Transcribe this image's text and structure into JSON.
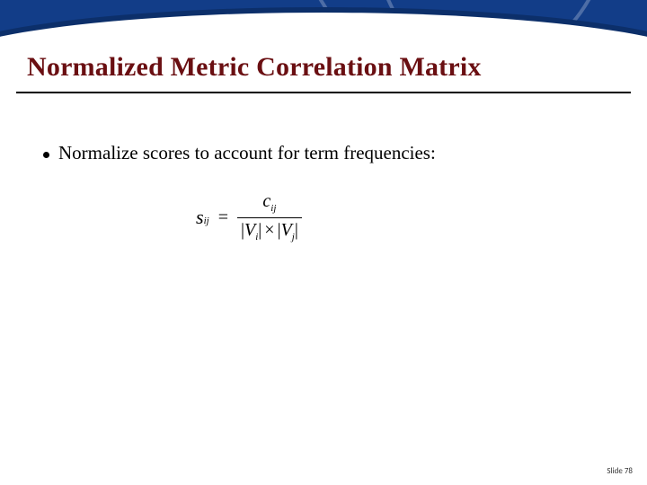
{
  "title": "Normalized Metric Correlation Matrix",
  "bullets": [
    {
      "text": "Normalize scores to account for term frequencies:"
    }
  ],
  "formula": {
    "lhs_var": "s",
    "lhs_sub": "ij",
    "eq": "=",
    "num_var": "c",
    "num_sub": "ij",
    "den_Vi_var": "V",
    "den_Vi_sub": "i",
    "den_times": "×",
    "den_Vj_var": "V",
    "den_Vj_sub": "j",
    "abs": "|"
  },
  "footer": {
    "label_prefix": "Slide ",
    "number": "78"
  },
  "colors": {
    "title": "#6a0f12",
    "banner": "#123d88"
  }
}
